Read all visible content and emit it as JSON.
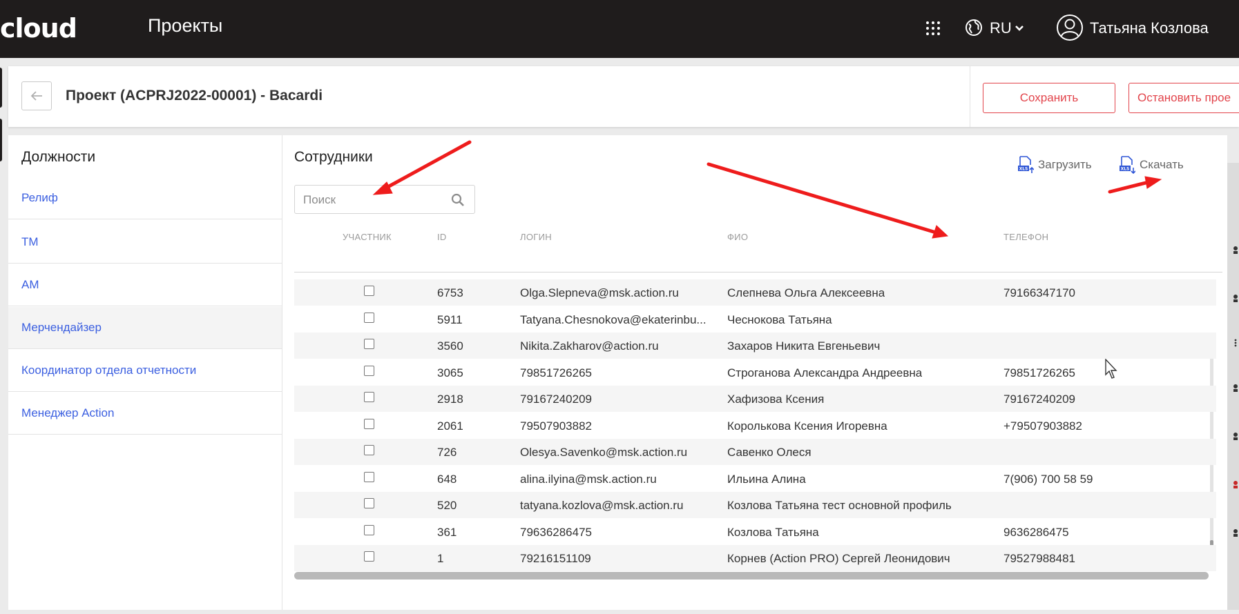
{
  "topbar": {
    "logo_text": "cloud",
    "title": "Проекты",
    "language": "RU",
    "user_name": "Татьяна Козлова"
  },
  "header": {
    "project_title": "Проект (ACPRJ2022-00001) - Bacardi",
    "save_label": "Сохранить",
    "stop_label": "Остановить прое"
  },
  "positions_panel": {
    "title": "Должности",
    "items": [
      {
        "label": "Релиф"
      },
      {
        "label": "ТМ"
      },
      {
        "label": "АМ"
      },
      {
        "label": "Мерчендайзер",
        "active": true
      },
      {
        "label": "Координатор отдела отчетности"
      },
      {
        "label": "Менеджер Action"
      }
    ]
  },
  "employees_panel": {
    "title": "Сотрудники",
    "search": {
      "placeholder": "Поиск",
      "value": ""
    },
    "upload_label": "Загрузить",
    "download_label": "Скачать",
    "columns": {
      "participant": "УЧАСТНИК",
      "id": "ID",
      "login": "ЛОГИН",
      "fio": "ФИО",
      "phone": "ТЕЛЕФОН"
    },
    "rows": [
      {
        "id": "6753",
        "login": "Olga.Slepneva@msk.action.ru",
        "fio": "Слепнева Ольга Алексеевна",
        "phone": "79166347170"
      },
      {
        "id": "5911",
        "login": "Tatyana.Chesnokova@ekaterinbu...",
        "fio": "Чеснокова Татьяна",
        "phone": ""
      },
      {
        "id": "3560",
        "login": "Nikita.Zakharov@action.ru",
        "fio": "Захаров Никита Евгеньевич",
        "phone": ""
      },
      {
        "id": "3065",
        "login": "79851726265",
        "fio": "Строганова Александра Андреевна",
        "phone": "79851726265"
      },
      {
        "id": "2918",
        "login": "79167240209",
        "fio": "Хафизова Ксения",
        "phone": "79167240209"
      },
      {
        "id": "2061",
        "login": "79507903882",
        "fio": "Королькова Ксения Игоревна",
        "phone": "+79507903882"
      },
      {
        "id": "726",
        "login": "Olesya.Savenko@msk.action.ru",
        "fio": "Савенко Олеся",
        "phone": ""
      },
      {
        "id": "648",
        "login": "alina.ilyina@msk.action.ru",
        "fio": "Ильина Алина",
        "phone": "7(906) 700 58 59"
      },
      {
        "id": "520",
        "login": "tatyana.kozlova@msk.action.ru",
        "fio": "Козлова Татьяна тест основной профиль",
        "phone": ""
      },
      {
        "id": "361",
        "login": "79636286475",
        "fio": "Козлова Татьяна",
        "phone": "9636286475"
      },
      {
        "id": "1",
        "login": "79216151109",
        "fio": "Корнев (Action PRO) Сергей Леонидович",
        "phone": "79527988481"
      }
    ]
  },
  "colors": {
    "topbar_bg": "#1f1c1c",
    "link_blue": "#3b5fe0",
    "accent_red": "#e2444b",
    "annotation_red": "#ee1c1c",
    "xls_icon_blue": "#2f56d6"
  },
  "icons": [
    "apps-grid-icon",
    "globe-icon",
    "chevron-down-icon",
    "user-avatar-icon",
    "arrow-left-icon",
    "search-icon",
    "xls-upload-icon",
    "xls-download-icon",
    "mouse-cursor-icon"
  ]
}
